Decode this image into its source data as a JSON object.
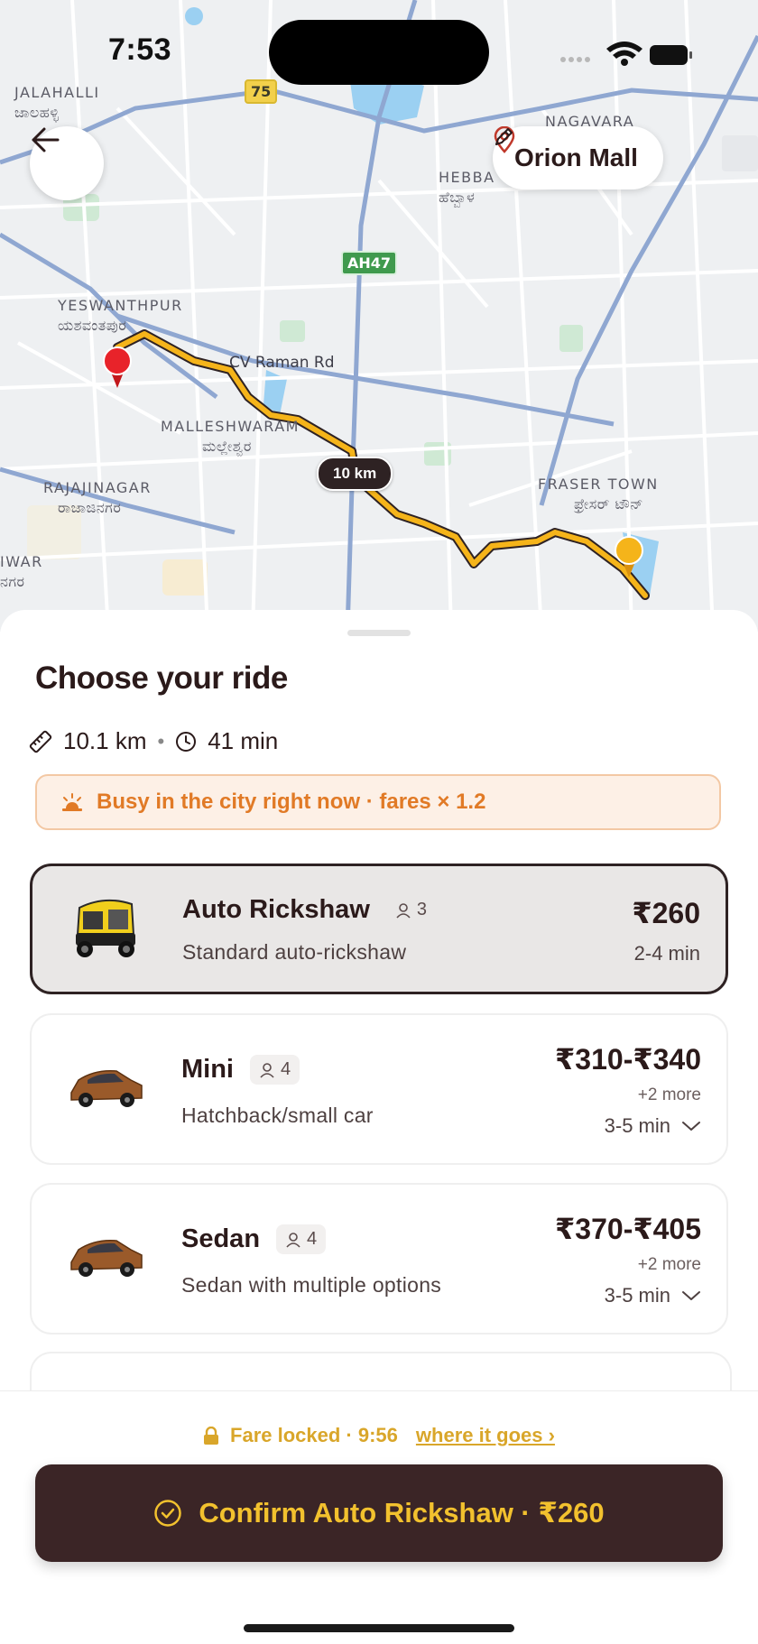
{
  "status_bar": {
    "time": "7:53"
  },
  "map": {
    "areas": [
      {
        "name": "JALAHALLI",
        "local": "ಜಾಲಹಳ್ಳಿ"
      },
      {
        "name": "HEBBA",
        "local": "ಹೆಬ್ಬಾಳ"
      },
      {
        "name": "YESWANTHPUR",
        "local": "ಯಶವಂತಪುರ"
      },
      {
        "name": "MALLESHWARAM",
        "local": "ಮಲ್ಲೇಶ್ವರ"
      },
      {
        "name": "RAJAJINAGAR",
        "local": "ರಾಜಾಜಿನಗರ"
      },
      {
        "name": "FRASER TOWN",
        "local": "ಫ್ರೇಸರ್ ಟೌನ್"
      },
      {
        "name": "NAGAVARA",
        "local": ""
      },
      {
        "name": "IWAR",
        "local": "ನಗರ"
      }
    ],
    "road_label": "CV Raman Rd",
    "shields": {
      "s1": "75",
      "s2": "AH47"
    },
    "distance_badge": "10 km",
    "destination": "Orion Mall"
  },
  "sheet": {
    "title": "Choose your ride",
    "distance": "10.1 km",
    "separator": "•",
    "duration": "41 min",
    "surge_text": "Busy in the city right now · fares × 1.2",
    "rides": [
      {
        "name": "Auto Rickshaw",
        "seats": "3",
        "description": "Standard auto-rickshaw",
        "price": "₹260",
        "eta": "2-4 min",
        "selected": true
      },
      {
        "name": "Mini",
        "seats": "4",
        "description": "Hatchback/small car",
        "price": "₹310-₹340",
        "more": "+2 more",
        "eta": "3-5 min"
      },
      {
        "name": "Sedan",
        "seats": "4",
        "description": "Sedan with multiple options",
        "price": "₹370-₹405",
        "more": "+2 more",
        "eta": "3-5 min"
      }
    ]
  },
  "footer": {
    "fare_lock": "Fare locked · 9:56",
    "fare_link": "where it goes ›",
    "confirm_label": "Confirm Auto Rickshaw · ₹260"
  },
  "colors": {
    "brand_dark": "#3b2526",
    "accent_yellow": "#f2c12e",
    "route": "#f5b41a",
    "surge_orange": "#e17a26"
  }
}
